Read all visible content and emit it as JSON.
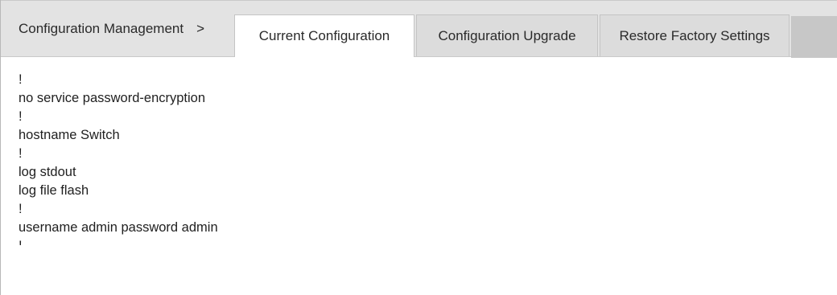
{
  "breadcrumb": {
    "section": "Configuration Management",
    "separator": ">"
  },
  "tabs": [
    {
      "label": "Current Configuration",
      "active": true
    },
    {
      "label": "Configuration Upgrade",
      "active": false
    },
    {
      "label": "Restore Factory Settings",
      "active": false
    }
  ],
  "config_lines": [
    "!",
    "no service password-encryption",
    "!",
    "hostname Switch",
    "!",
    "log stdout",
    "log file flash",
    "!",
    "username admin password admin",
    "!"
  ]
}
